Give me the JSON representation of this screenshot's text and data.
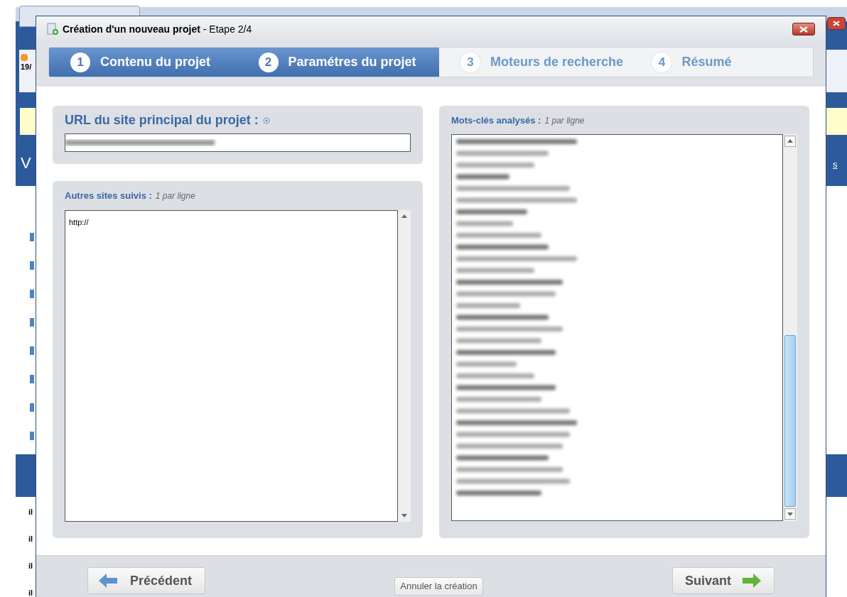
{
  "background": {
    "date_fragment": "19/",
    "heading_fragment": "V",
    "link_fragment": "s",
    "row_fragments": [
      "il",
      "il",
      "il",
      "il"
    ]
  },
  "dialog": {
    "title": "Création d'un nouveau projet",
    "subtitle": "- Etape 2/4"
  },
  "steps": [
    {
      "number": "1",
      "label": "Contenu du projet",
      "reached": true
    },
    {
      "number": "2",
      "label": "Paramétres du projet",
      "reached": true
    },
    {
      "number": "3",
      "label": "Moteurs de recherche",
      "reached": false
    },
    {
      "number": "4",
      "label": "Résumé",
      "reached": false
    }
  ],
  "main_url": {
    "label": "URL du site principal du projet :"
  },
  "other_sites": {
    "label": "Autres sites suivis :",
    "hint": "1 par ligne",
    "value": "http://"
  },
  "keywords": {
    "label": "Mots-clés analysés :",
    "hint": "1 par ligne"
  },
  "footer": {
    "previous": "Précédent",
    "cancel": "Annuler la création",
    "next": "Suivant"
  }
}
